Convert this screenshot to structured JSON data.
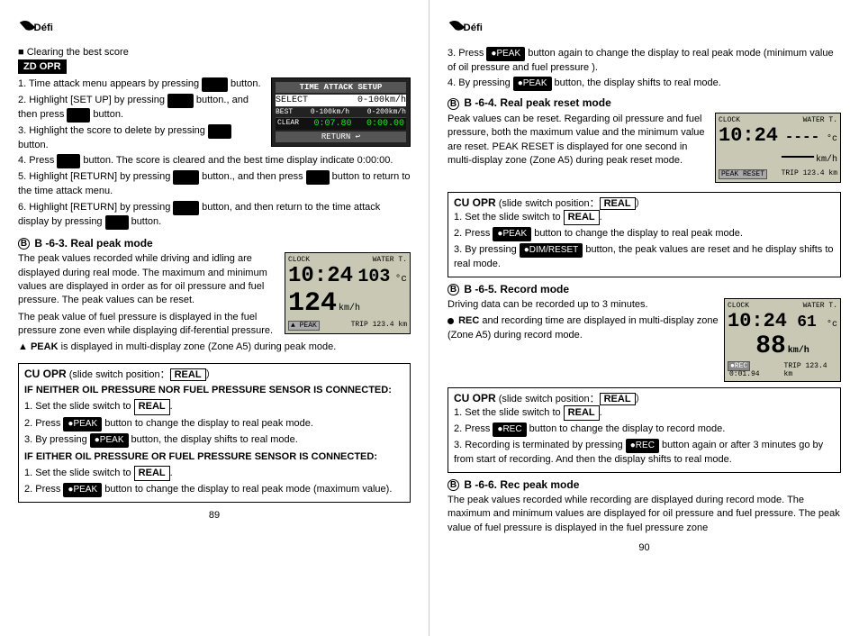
{
  "left_page": {
    "page_num": "89",
    "logo_text": "Défi",
    "clearing_title": "■ Clearing the best score",
    "zd_opr_label": "ZD OPR",
    "steps": [
      "1. Time attack menu appears by pressing  button.",
      "2. Highlight [SET UP] by pressing  button., and then press  button.",
      "3. Highlight the score to delete by pressing  button.",
      "4. Press  button.  The score is cleared and the best time display indicate 0:00:00.",
      "5. Highlight [RETURN] by pressing  button., and then press  button to return to the time attack menu.",
      "6. Highlight [RETURN] by pressing  button, and then return to the time attack display by pressing  button."
    ],
    "section_b63_title": "B -6-3. Real peak mode",
    "para1": "The peak values recorded while driving and idling are displayed during real mode.  The maximum and minimum values are displayed in order as for oil pressure and fuel pressure.  The peak values can be reset.",
    "para2": " The peak value of fuel pressure is displayed in the fuel pressure zone even while displaying dif-ferential pressure.",
    "para3": "▲ PEAK is displayed in multi-display zone (Zone A5) during peak mode.",
    "cu_opr_label": "CU OPR",
    "slide_text": " (slide switch position：",
    "real_label": "REAL",
    "slide_close": "）",
    "if_neither": "IF NEITHER OIL PRESSURE NOR FUEL PRESSURE SENSOR IS CONNECTED:",
    "steps_cu1": [
      "1. Set the slide switch to  REAL .",
      "2. Press ●PEAK button to change the display to real peak mode.",
      "3. By pressing ●PEAK button, the display shifts to real mode."
    ],
    "if_either": "IF EITHER OIL PRESSURE OR FUEL PRESSURE SENSOR IS CONNECTED:",
    "steps_cu2": [
      "1. Set the slide switch to  REAL .",
      "2. Press ●PEAK button to change the display to real peak mode (maximum value)."
    ],
    "lcd_setup": {
      "header": "TIME ATTACK SETUP",
      "row_select": "SELECT",
      "row_range": "0-100km/h",
      "best_label": "BEST",
      "best_val": "0:07.80",
      "range2": "0-200km/h",
      "val2": "0:00.00",
      "clear_label": "CLEAR",
      "return_label": "RETURN ↩"
    },
    "peak_lcd": {
      "clock_label": "CLOCK",
      "water_label": "WATER T.",
      "time": "10:24",
      "temp": "103",
      "temp_unit": "°c",
      "speed": "124",
      "speed_unit": "km/h",
      "peak_label": "▲ PEAK",
      "trip_label": "TRIP",
      "trip_val": "123.4 km"
    }
  },
  "right_page": {
    "page_num": "90",
    "logo_text": "Défi",
    "step3_text": "3. Press ●PEAK button again to change the display to real peak mode (minimum value of oil pressure and fuel pressure ).",
    "step4_text": "4. By pressing ●PEAK button, the display shifts to real mode.",
    "section_b64_title": "B -6-4. Real peak reset mode",
    "para_b64_1": "Peak values can be reset.  Regarding oil pressure and fuel pressure, both the maximum value and the minimum value are reset.  PEAK RESET is displayed for one second in multi-display zone (Zone A5) during peak reset mode.",
    "cu_opr_label": "CU OPR",
    "slide_text": " (slide switch position：",
    "real_label": "REAL",
    "steps_b64": [
      "1. Set the slide switch to  REAL .",
      "2. Press ●PEAK button to change the display to real peak mode.",
      "3. By pressing ●DIM/RESET button, the peak values are reset and he display shifts to real mode."
    ],
    "section_b65_title": "B -6-5. Record mode",
    "para_b65_1": "Driving data can be recorded up to 3 minutes.",
    "rec_bullet": "● REC and recording time are displayed in multi-display zone (Zone A5) during record mode.",
    "cu_opr_label2": "CU OPR",
    "steps_b65": [
      "1. Set the slide switch to  REAL .",
      "2. Press ●REC button to change the display to record mode.",
      "3. Recording is terminated by pressing  ●REC button again or after 3 minutes go by from start of recording.  And then the display shifts to real mode."
    ],
    "section_b66_title": "B -6-6. Rec peak mode",
    "para_b66_1": "The peak values recorded while recording are displayed during record mode. The maximum and minimum values are displayed for oil pressure and fuel pressure.  The peak value of fuel pressure is displayed in the fuel pressure zone",
    "peak_reset_lcd": {
      "clock_label": "CLOCK",
      "water_label": "WATER T.",
      "time": "10:24",
      "temp": "----",
      "temp_unit": "°c",
      "speed_dashes": "———",
      "speed_unit": "km/h",
      "peak_label": "PEAK RESET",
      "trip_label": "TRIP",
      "trip_val": "123.4 km"
    },
    "rec_lcd": {
      "clock_label": "CLOCK",
      "water_label": "WATER T.",
      "time": "10:24",
      "temp": "61",
      "temp_unit": "°c",
      "speed": "88",
      "speed_unit": "km/h",
      "rec_label": "●REC",
      "rec_time": "0:01.94",
      "trip_label": "TRIP",
      "trip_val": "123.4 km"
    }
  }
}
